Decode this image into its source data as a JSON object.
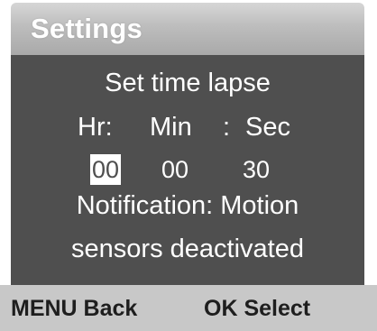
{
  "header": {
    "title": "Settings"
  },
  "panel": {
    "title": "Set time lapse",
    "units": {
      "hour_label": "Hr:",
      "minute_label": "Min",
      "separator": ":",
      "second_label": "Sec"
    },
    "values": {
      "hours": "00",
      "minutes": "00",
      "seconds": "30",
      "selected_field": "hours"
    },
    "notification": {
      "line1": "Notification: Motion",
      "line2": "sensors deactivated"
    }
  },
  "footer": {
    "back_label": "MENU Back",
    "select_label": "OK Select"
  },
  "colors": {
    "panel_background": "#4f4f4f",
    "header_background": "#bdbdbd",
    "footer_background": "#c8c8c8",
    "text_light": "#ffffff",
    "text_dark": "#1e1e1e"
  }
}
